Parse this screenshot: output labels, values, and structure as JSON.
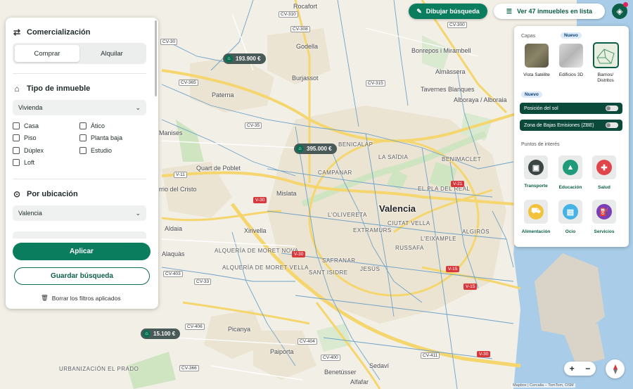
{
  "map": {
    "city_label": "Valencia",
    "places": [
      "Rocafort",
      "Godella",
      "Burjassot",
      "Paterna",
      "Bonrepos i Mirambell",
      "Almàssera",
      "Tavernes Blanques",
      "Alboraya / Alboraia",
      "Manises",
      "Quart de Poblet",
      "Mislata",
      "rrio del Cristo",
      "Aldaia",
      "Xirivella",
      "Alaquàs",
      "Picanya",
      "Paiporta",
      "Benetússer",
      "Sedaví",
      "Alfafar"
    ],
    "districts": [
      "BENICALAP",
      "LA SAÏDIA",
      "BENIMACLET",
      "CAMPANAR",
      "EL PLA DEL REAL",
      "L'OLIVERETA",
      "ALGIRÓS",
      "EXTRAMURS",
      "CIUTAT VELLA",
      "L'EIXAMPLE",
      "RUSSAFA",
      "ALQUERÍA DE MORET NOVA",
      "ALQUERÍA DE MORET VELLA",
      "JESÚS",
      "SAFRANAR",
      "SANT ISIDRE",
      "URBANIZACIÓN EL PRADO"
    ],
    "roads": [
      "CV-310",
      "CV-308",
      "CV-300",
      "CV-315",
      "CV-365",
      "CV-35",
      "CV-30",
      "V-11",
      "V-30",
      "V-21",
      "V-15",
      "CV-33",
      "CV-403",
      "CV-406",
      "CV-400",
      "CV-404",
      "CV-366",
      "CV-411"
    ],
    "price_markers": [
      "193.900 €",
      "395.000 €",
      "15.100 €"
    ],
    "attribution": "Mapbox | Cercalia – TomTom, OSM"
  },
  "filters": {
    "commercialization": {
      "title": "Comercialización",
      "options": [
        "Comprar",
        "Alquilar"
      ],
      "selected": "Comprar"
    },
    "property_type": {
      "title": "Tipo de inmueble",
      "selected": "Vivienda",
      "checks_left": [
        "Casa",
        "Piso",
        "Dúplex",
        "Loft"
      ],
      "checks_right": [
        "Ático",
        "Planta baja",
        "Estudio"
      ]
    },
    "location": {
      "title": "Por ubicación",
      "selected": "Valencia"
    },
    "apply_label": "Aplicar",
    "save_label": "Guardar búsqueda",
    "clear_label": "Borrar los filtros aplicados"
  },
  "toolbar": {
    "draw_label": "Dibujar búsqueda",
    "list_label": "Ver 47 inmuebles en lista"
  },
  "layers": {
    "layers_label": "Capas",
    "new_badge": "Nuevo",
    "new_badge_2": "Nuevo",
    "thumbs": [
      "Vista Satélite",
      "Edificios 3D",
      "Barrios/ Distritos"
    ],
    "toggle_sun": "Posición del sol",
    "toggle_zbe": "Zona de Bajas Emisiones (ZBE)",
    "poi_label": "Puntos de interés",
    "pois": [
      {
        "label": "Transporte",
        "color": "#3c4444"
      },
      {
        "label": "Educación",
        "color": "#1f9a7a"
      },
      {
        "label": "Salud",
        "color": "#e0454b"
      },
      {
        "label": "Alimentación",
        "color": "#f2c23a"
      },
      {
        "label": "Ocio",
        "color": "#45b3e6"
      },
      {
        "label": "Servicios",
        "color": "#7a3fb8"
      }
    ]
  }
}
